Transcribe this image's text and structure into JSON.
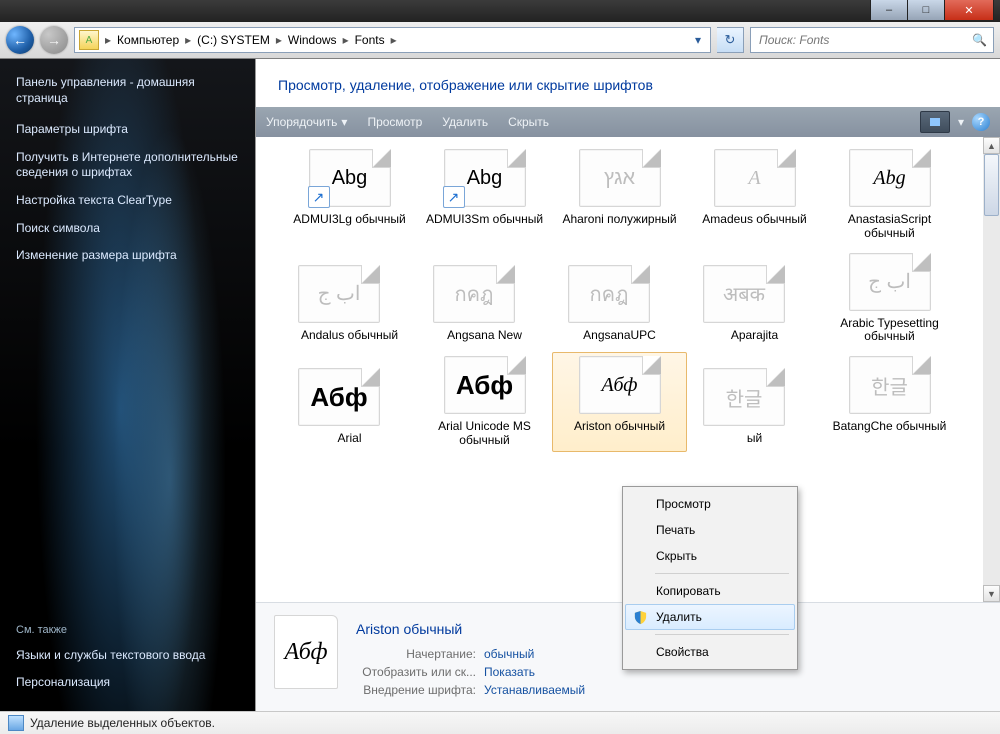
{
  "title_buttons": {
    "min": "–",
    "max": "□",
    "close": "✕"
  },
  "breadcrumb": {
    "icon_letter": "A",
    "items": [
      "Компьютер",
      "(С:) SYSTEM",
      "Windows",
      "Fonts"
    ]
  },
  "search": {
    "placeholder": "Поиск: Fonts"
  },
  "header": "Просмотр, удаление, отображение или скрытие шрифтов",
  "cmdbar": {
    "organize": "Упорядочить",
    "preview": "Просмотр",
    "delete": "Удалить",
    "hide": "Скрыть"
  },
  "sidebar": {
    "title": "Панель управления - домашняя страница",
    "links": [
      "Параметры шрифта",
      "Получить в Интернете дополнительные сведения о шрифтах",
      "Настройка текста ClearType",
      "Поиск символа",
      "Изменение размера шрифта"
    ],
    "footer_header": "См. также",
    "footer_links": [
      "Языки и службы текстового ввода",
      "Персонализация"
    ]
  },
  "fonts": [
    [
      {
        "sample": "Abg",
        "cls": "",
        "name": "ADMUI3Lg обычный",
        "shortcut": true
      },
      {
        "sample": "Abg",
        "cls": "",
        "name": "ADMUI3Sm обычный",
        "shortcut": true
      },
      {
        "sample": "אגץ",
        "cls": "dim hebrew",
        "name": "Aharoni полужирный"
      },
      {
        "sample": "A",
        "cls": "dim script",
        "name": "Amadeus обычный",
        "special": "amadeus"
      },
      {
        "sample": "Abg",
        "cls": "script",
        "name": "AnastasiaScript обычный"
      }
    ],
    [
      {
        "sample": "اب ج",
        "cls": "dim",
        "name": "Andalus обычный",
        "stack": true,
        "dir": "rtl"
      },
      {
        "sample": "กคฎ",
        "cls": "dim",
        "name": "Angsana New",
        "stack": true
      },
      {
        "sample": "กคฎ",
        "cls": "dim",
        "name": "AngsanaUPC",
        "stack": true
      },
      {
        "sample": "अबक",
        "cls": "dim deva",
        "name": "Aparajita",
        "stack": true
      },
      {
        "sample": "اب ج",
        "cls": "dim",
        "name": "Arabic Typesetting обычный",
        "dir": "rtl"
      }
    ],
    [
      {
        "sample": "Абф",
        "cls": "",
        "name": "Arial",
        "stack": true,
        "big": true
      },
      {
        "sample": "Абф",
        "cls": "",
        "name": "Arial Unicode MS обычный",
        "big": true
      },
      {
        "sample": "Абф",
        "cls": "script",
        "name": "Ariston обычный",
        "selected": true
      },
      {
        "sample": "한글",
        "cls": "dim",
        "name": "",
        "stack": true,
        "trunc": "ый"
      },
      {
        "sample": "한글",
        "cls": "dim",
        "name": "BatangChe обычный"
      }
    ]
  ],
  "context_menu": {
    "items": [
      {
        "label": "Просмотр"
      },
      {
        "label": "Печать"
      },
      {
        "label": "Скрыть"
      },
      {
        "sep": true
      },
      {
        "label": "Копировать"
      },
      {
        "label": "Удалить",
        "hl": true,
        "shield": true
      },
      {
        "sep": true
      },
      {
        "label": "Свойства"
      }
    ]
  },
  "details": {
    "title": "Ariston обычный",
    "sample": "Абф",
    "rows": [
      {
        "k": "Начертание:",
        "v": "обычный"
      },
      {
        "k": "Отобразить или ск...",
        "v": "Показать"
      },
      {
        "k": "Внедрение шрифта:",
        "v": "Устанавливаемый"
      }
    ]
  },
  "statusbar": "Удаление выделенных объектов."
}
